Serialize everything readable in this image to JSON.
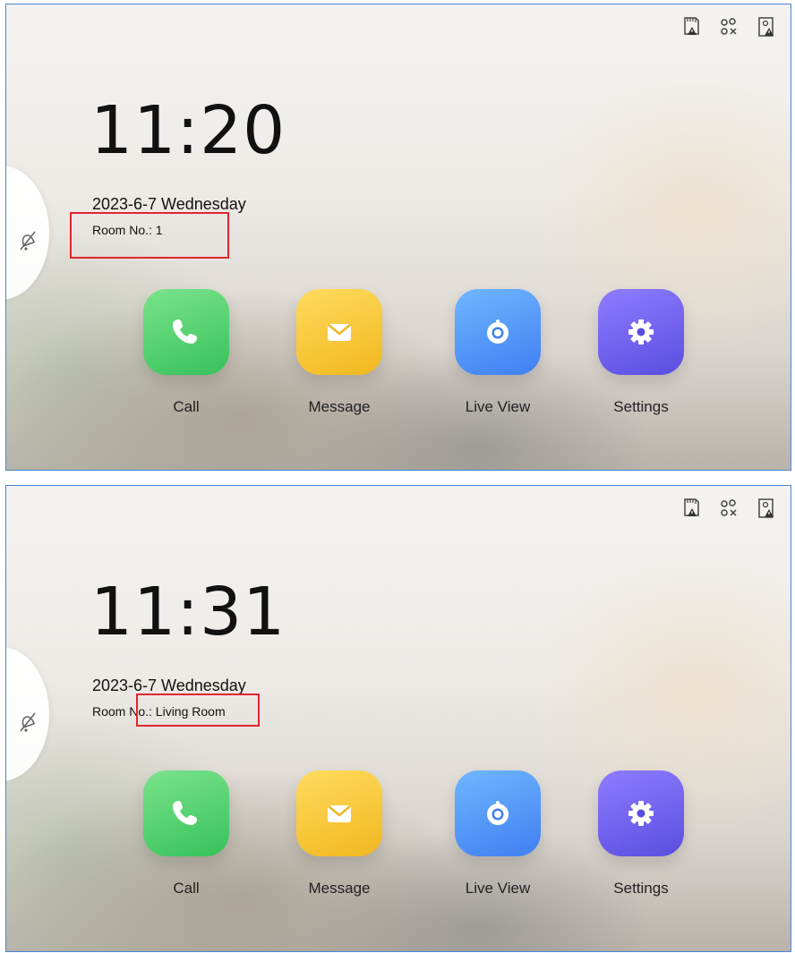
{
  "screens": [
    {
      "time": "11:20",
      "date": "2023-6-7  Wednesday",
      "room": "Room No.: 1",
      "apps": {
        "call": "Call",
        "message": "Message",
        "live_view": "Live View",
        "settings": "Settings"
      }
    },
    {
      "time": "11:31",
      "date": "2023-6-7  Wednesday",
      "room": "Room No.: Living Room",
      "apps": {
        "call": "Call",
        "message": "Message",
        "live_view": "Live View",
        "settings": "Settings"
      }
    }
  ],
  "icons": {
    "status": [
      "sd-card-warning-icon",
      "network-disconnected-icon",
      "door-station-warning-icon"
    ],
    "side": "bell-mute-icon",
    "apps": [
      "phone-icon",
      "envelope-icon",
      "camera-icon",
      "gear-icon"
    ]
  },
  "colors": {
    "highlight": "#e0262e",
    "call": "#36c25a",
    "message": "#f1b81f",
    "live_view": "#3f7ff2",
    "settings": "#5a4ee0"
  }
}
